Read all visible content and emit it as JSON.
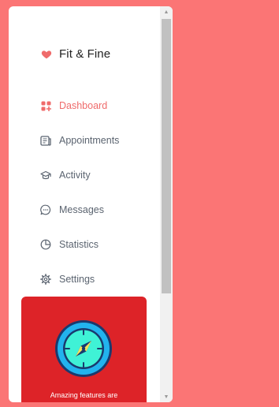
{
  "brand": {
    "icon": "heart-icon",
    "title": "Fit & Fine",
    "accent_color": "#ef6b6b"
  },
  "nav": [
    {
      "label": "Dashboard",
      "icon": "dashboard-icon",
      "active": true
    },
    {
      "label": "Appointments",
      "icon": "appointments-icon",
      "active": false
    },
    {
      "label": "Activity",
      "icon": "graduation-cap-icon",
      "active": false
    },
    {
      "label": "Messages",
      "icon": "chat-bubble-icon",
      "active": false
    },
    {
      "label": "Statistics",
      "icon": "pie-chart-icon",
      "active": false
    },
    {
      "label": "Settings",
      "icon": "gear-icon",
      "active": false
    }
  ],
  "promo": {
    "icon": "compass-icon",
    "text": "Amazing features are",
    "background_color": "#dd2328"
  },
  "colors": {
    "page_background": "#fb7575",
    "text_muted": "#5b6470"
  }
}
